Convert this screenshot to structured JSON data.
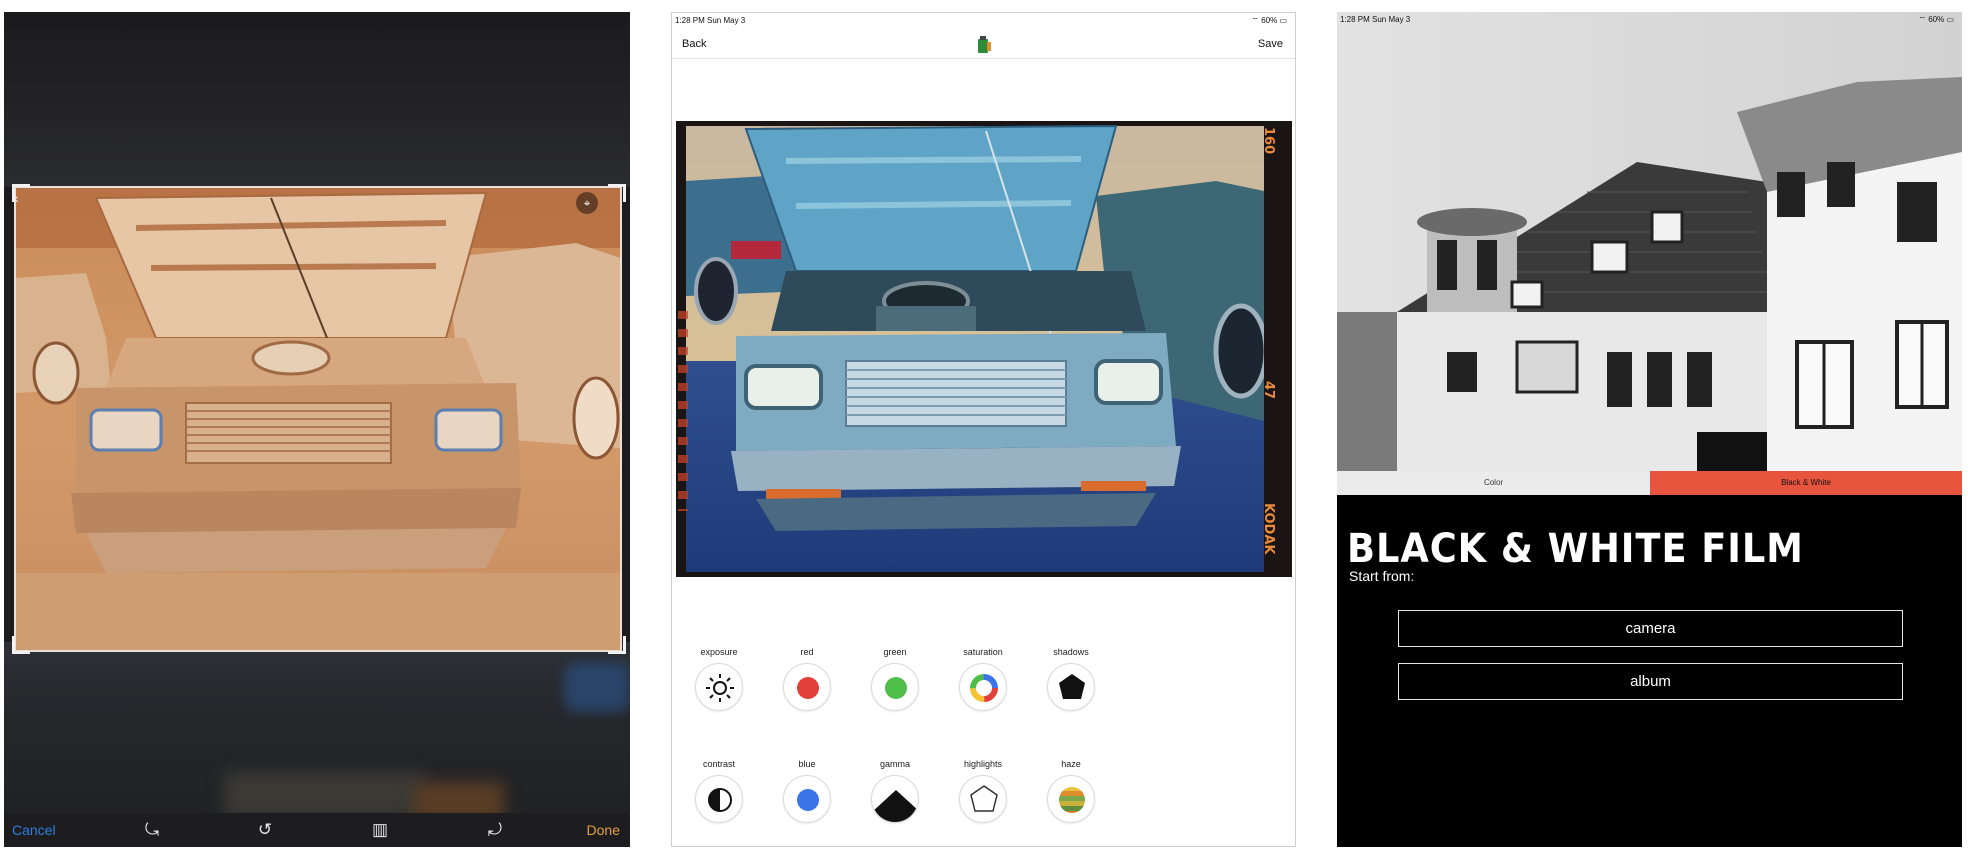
{
  "crop_editor": {
    "toolbar": {
      "cancel_label": "Cancel",
      "done_label": "Done",
      "icons": [
        "rotate-left-icon",
        "undo-rotate-icon",
        "aspect-ratio-icon",
        "rotate-right-icon"
      ]
    }
  },
  "film_editor": {
    "status": {
      "time": "1:28 PM   Sun May 3",
      "battery": "60%"
    },
    "nav": {
      "back_label": "Back",
      "save_label": "Save"
    },
    "film_markings": {
      "top_right": "160",
      "mid_right": "47",
      "brand": "KODAK"
    },
    "adjustments": [
      {
        "label": "exposure",
        "icon": "sun-icon"
      },
      {
        "label": "red",
        "icon": "red-dot-icon",
        "color": "#e1403a"
      },
      {
        "label": "green",
        "icon": "green-dot-icon",
        "color": "#4fbf4a"
      },
      {
        "label": "saturation",
        "icon": "color-wheel-icon"
      },
      {
        "label": "shadows",
        "icon": "pentagon-filled-icon"
      },
      {
        "label": "contrast",
        "icon": "half-circle-icon"
      },
      {
        "label": "blue",
        "icon": "blue-dot-icon",
        "color": "#3a74e6"
      },
      {
        "label": "gamma",
        "icon": "gamma-icon"
      },
      {
        "label": "highlights",
        "icon": "pentagon-outline-icon"
      },
      {
        "label": "haze",
        "icon": "haze-stripes-icon"
      }
    ]
  },
  "film_chooser": {
    "status": {
      "time": "1:28 PM   Sun May 3",
      "battery": "60%"
    },
    "segments": {
      "color_label": "Color",
      "bw_label": "Black & White",
      "selected": "Black & White",
      "accent": "#e8553f"
    },
    "title": "BLACK & WHITE FILM",
    "subtitle": "Start from:",
    "buttons": {
      "camera_label": "camera",
      "album_label": "album"
    }
  }
}
